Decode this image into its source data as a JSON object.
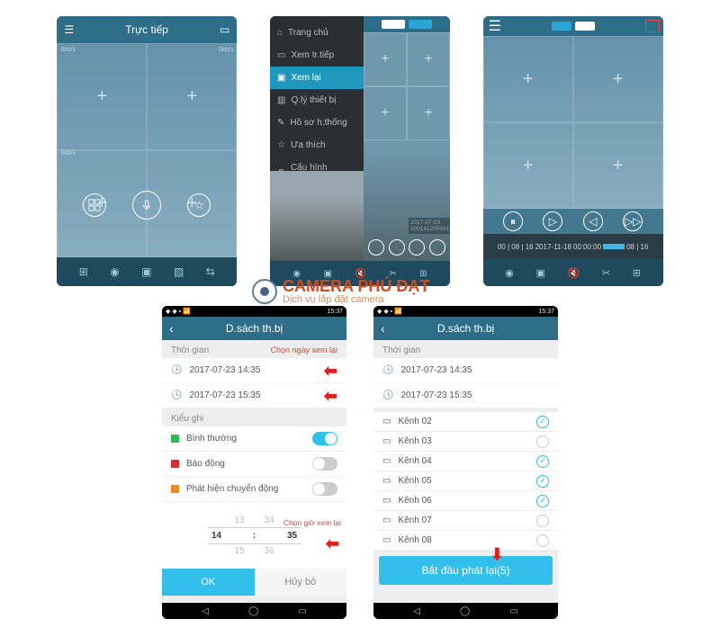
{
  "screen1": {
    "title": "Trực tiếp",
    "kbps": "0kb/s",
    "bottom_icons": [
      "grid-icon",
      "camera-icon",
      "record-icon",
      "image-icon",
      "swap-icon"
    ],
    "ctrl_icons": [
      "layout-icon",
      "mic-icon",
      "star-icon"
    ]
  },
  "screen2": {
    "menu": [
      {
        "icon": "home-icon",
        "label": "Trang chủ"
      },
      {
        "icon": "live-icon",
        "label": "Xem tr.tiếp"
      },
      {
        "icon": "playback-icon",
        "label": "Xem lại",
        "active": true
      },
      {
        "icon": "devmgr-icon",
        "label": "Q.lý thiết bị"
      },
      {
        "icon": "profile-icon",
        "label": "Hồ sơ h.thống"
      },
      {
        "icon": "fav-icon",
        "label": "Ưa thích"
      },
      {
        "icon": "settings-icon",
        "label": "Cấu hình h.thống"
      }
    ],
    "timeline": "2017-07-23"
  },
  "screen3": {
    "timeline_date": "2017-11-18",
    "timeline_time": "00:00:00"
  },
  "screen4": {
    "status_time": "15:37",
    "title": "D.sách th.bị",
    "time_section": "Thời gian",
    "note_date": "Chọn ngày xem lại",
    "time_from": "2017-07-23 14:35",
    "time_to": "2017-07-23 15:35",
    "record_section": "Kiểu ghi",
    "r_normal": "Bình thường",
    "r_alarm": "Báo động",
    "r_motion": "Phát hiện chuyển động",
    "note_time": "Chọn giờ xem lại",
    "picker": {
      "above": [
        "13",
        "34"
      ],
      "mid": [
        "14",
        ":",
        "35"
      ],
      "below": [
        "15",
        "36"
      ]
    },
    "ok": "OK",
    "cancel": "Hủy bỏ"
  },
  "screen5": {
    "status_time": "15:37",
    "title": "D.sách th.bị",
    "time_section": "Thời gian",
    "time_from": "2017-07-23 14:35",
    "time_to": "2017-07-23 15:35",
    "channels": [
      {
        "label": "Kênh 02",
        "sel": true
      },
      {
        "label": "Kênh 03",
        "sel": false
      },
      {
        "label": "Kênh 04",
        "sel": true
      },
      {
        "label": "Kênh 05",
        "sel": true
      },
      {
        "label": "Kênh 06",
        "sel": true
      },
      {
        "label": "Kênh 07",
        "sel": false
      },
      {
        "label": "Kênh 08",
        "sel": false
      }
    ],
    "start": "Bắt đầu phát lại(5)"
  },
  "watermark": {
    "brand": "CAMERA PHÚ ĐẠT",
    "sub": "Dịch vụ lắp đặt camera"
  }
}
